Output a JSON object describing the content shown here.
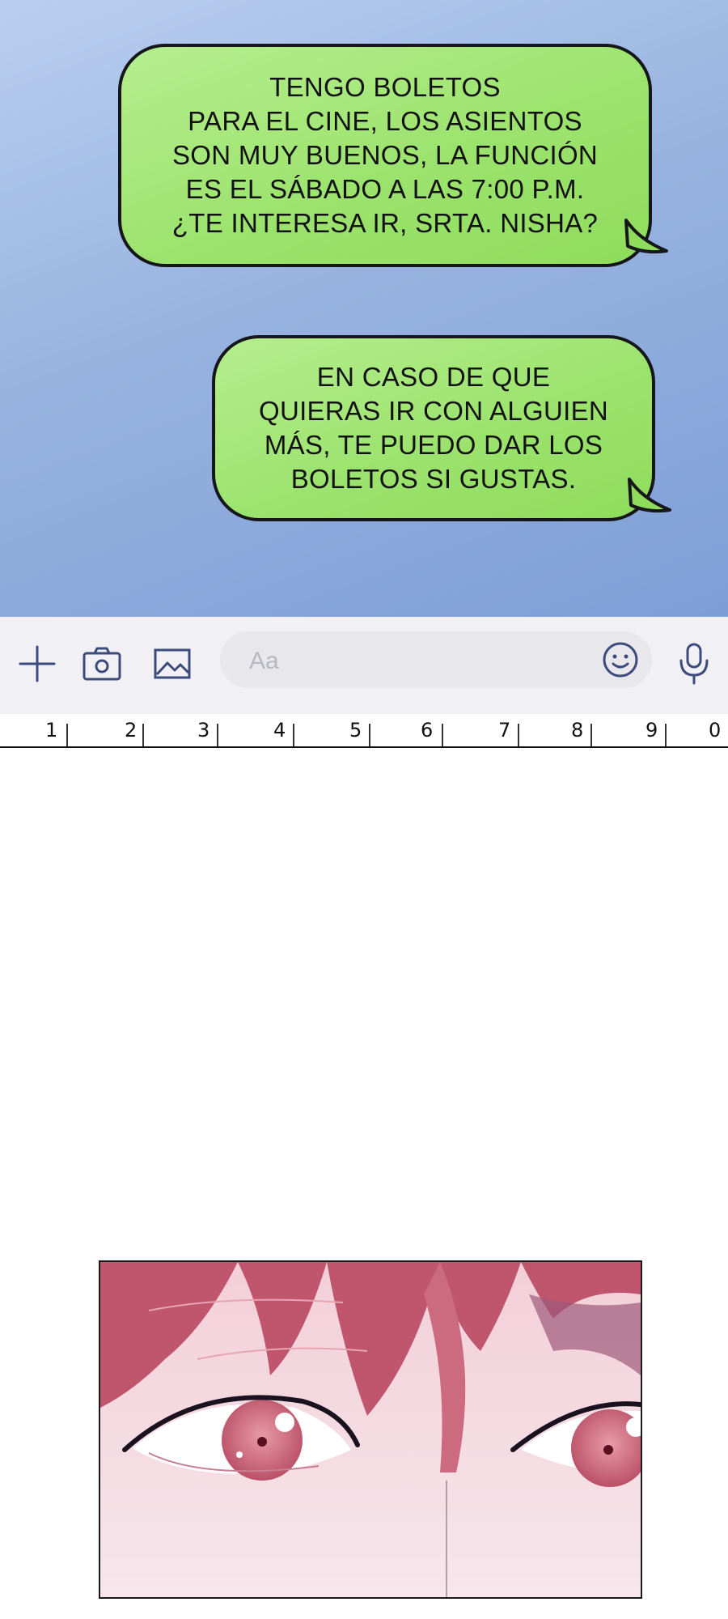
{
  "messages": [
    {
      "lines": [
        "TENGO BOLETOS",
        "PARA EL CINE, LOS ASIENTOS",
        "SON MUY BUENOS, LA FUNCIÓN",
        "ES EL SÁBADO A LAS 7:00 P.M.",
        "¿TE INTERESA IR, SRTA. NISHA?"
      ]
    },
    {
      "lines": [
        "EN CASO DE QUE",
        "QUIERAS IR CON ALGUIEN",
        "MÁS, TE PUEDO DAR LOS",
        "BOLETOS SI GUSTAS."
      ]
    }
  ],
  "composer": {
    "placeholder": "Aa",
    "icons": [
      "plus-icon",
      "camera-icon",
      "image-icon",
      "emoji-icon",
      "microphone-icon"
    ]
  },
  "ruler": {
    "numbers": [
      "1",
      "2",
      "3",
      "4",
      "5",
      "6",
      "7",
      "8",
      "9",
      "0"
    ]
  },
  "colors": {
    "chat_background": "#98b3e0",
    "bubble": "#9ce36e",
    "bubble_border": "#15171a",
    "toolbar": "#f1f1f5",
    "icon": "#3c4a7c"
  }
}
